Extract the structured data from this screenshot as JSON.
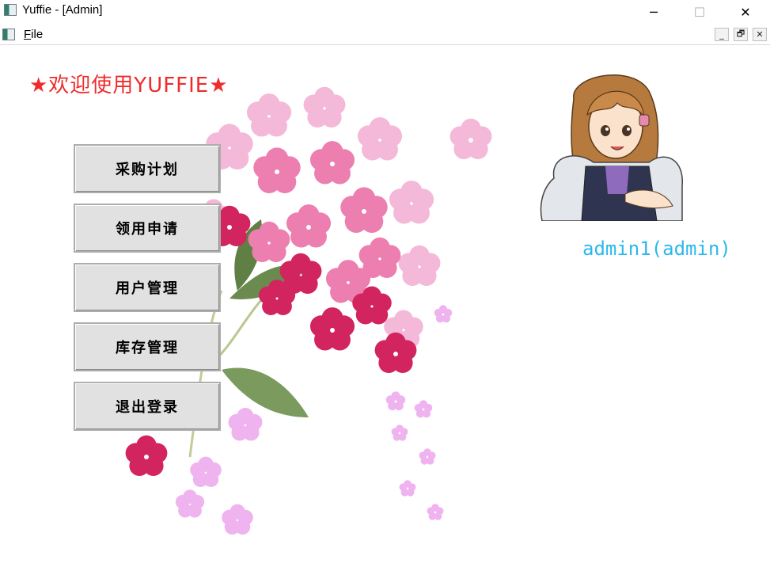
{
  "window": {
    "title": "Yuffie - [Admin]",
    "minimize_glyph": "─",
    "maximize_glyph": "☐",
    "close_glyph": "✕"
  },
  "menubar": {
    "file_label_first": "F",
    "file_label_rest": "ile",
    "mdi_minimize": "_",
    "mdi_restore": "🗗",
    "mdi_close": "✕"
  },
  "main": {
    "welcome_text": "★欢迎使用YUFFIE★",
    "buttons": [
      {
        "label": "采购计划"
      },
      {
        "label": "领用申请"
      },
      {
        "label": "用户管理"
      },
      {
        "label": "库存管理"
      },
      {
        "label": "退出登录"
      }
    ],
    "user_label": "admin1(admin)"
  },
  "colors": {
    "welcome": "#ef2b2b",
    "user": "#2bb8ee",
    "button_bg": "#e1e1e1"
  },
  "icons": {
    "app": "app-window-icon",
    "floral": "floral-illustration",
    "avatar": "character-avatar"
  }
}
